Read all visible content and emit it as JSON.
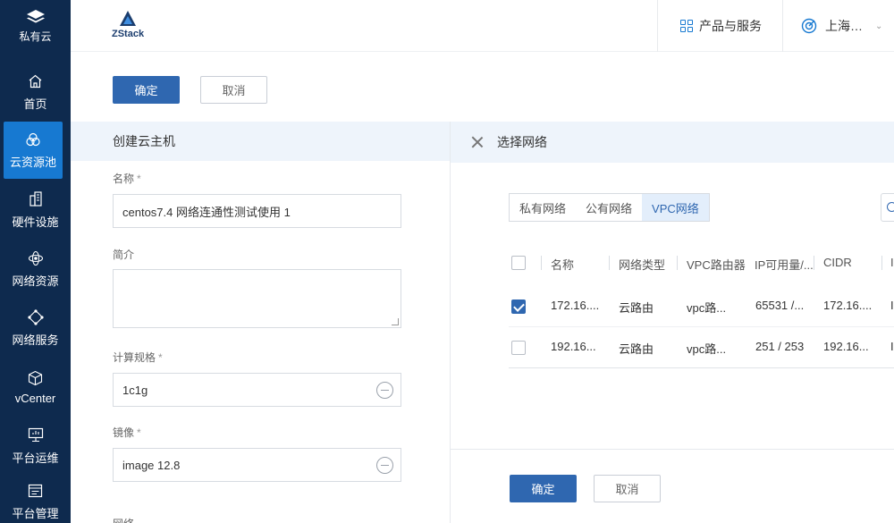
{
  "sidebar": {
    "brand": "私有云",
    "items": [
      {
        "label": "首页",
        "icon": "home-icon"
      },
      {
        "label": "云资源池",
        "icon": "cloud-pool-icon"
      },
      {
        "label": "硬件设施",
        "icon": "building-icon"
      },
      {
        "label": "网络资源",
        "icon": "network-resource-icon"
      },
      {
        "label": "网络服务",
        "icon": "network-service-icon"
      },
      {
        "label": "vCenter",
        "icon": "cube-icon"
      },
      {
        "label": "平台运维",
        "icon": "monitor-icon"
      },
      {
        "label": "平台管理",
        "icon": "management-icon"
      }
    ]
  },
  "header": {
    "logo_text": "ZStack",
    "products": "产品与服务",
    "region": "上海…"
  },
  "toolbar": {
    "confirm": "确定",
    "cancel": "取消"
  },
  "form": {
    "title": "创建云主机",
    "name_label": "名称",
    "name_value": "centos7.4 网络连通性测试使用 1",
    "desc_label": "简介",
    "spec_label": "计算规格",
    "spec_value": "1c1g",
    "image_label": "镜像",
    "image_value": "image 12.8",
    "network_label": "网络",
    "required": "*"
  },
  "panel": {
    "title": "选择网络",
    "tabs": [
      "私有网络",
      "公有网络",
      "VPC网络"
    ],
    "active_tab": "VPC网络",
    "columns": [
      "名称",
      "网络类型",
      "VPC路由器",
      "IP可用量/...",
      "CIDR",
      "I"
    ],
    "rows": [
      {
        "checked": true,
        "name": "172.16....",
        "type": "云路由",
        "router": "vpc路...",
        "ip": "65531 /...",
        "cidr": "172.16....",
        "extra": "I"
      },
      {
        "checked": false,
        "name": "192.16...",
        "type": "云路由",
        "router": "vpc路...",
        "ip": "251 / 253",
        "cidr": "192.16...",
        "extra": "I"
      }
    ],
    "confirm": "确定",
    "cancel": "取消"
  },
  "colors": {
    "sidebar_bg": "#0e2a4e",
    "active_nav": "#1779d1",
    "primary": "#2f67b0",
    "header_band": "#eef4fb"
  }
}
